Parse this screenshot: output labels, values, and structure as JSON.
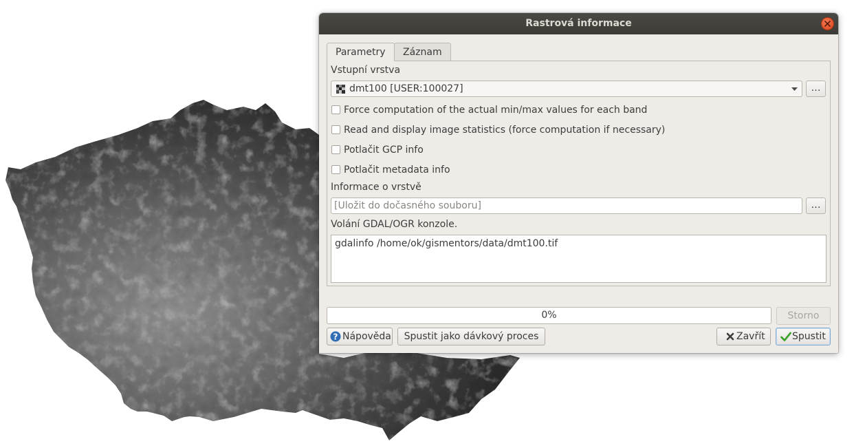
{
  "dialog": {
    "title": "Rastrová informace",
    "tabs": [
      {
        "label": "Parametry",
        "active": true
      },
      {
        "label": "Záznam",
        "active": false
      }
    ],
    "input_layer": {
      "label": "Vstupní vrstva",
      "selected": "dmt100 [USER:100027]",
      "browse_label": "…"
    },
    "options": [
      {
        "label": "Force computation of the actual min/max values for each band",
        "checked": false
      },
      {
        "label": "Read and display image statistics (force computation if necessary)",
        "checked": false
      },
      {
        "label": "Potlačit GCP info",
        "checked": false
      },
      {
        "label": "Potlačit metadata info",
        "checked": false
      }
    ],
    "output": {
      "label": "Informace o vrstvě",
      "placeholder": "[Uložit do dočasného souboru]",
      "browse_label": "…"
    },
    "console": {
      "label": "Volání GDAL/OGR konzole.",
      "command": "gdalinfo /home/ok/gismentors/data/dmt100.tif"
    },
    "progress": {
      "value": 0,
      "text": "0%"
    },
    "buttons": {
      "cancel": "Storno",
      "help": "Nápověda",
      "batch": "Spustit jako dávkový proces",
      "close": "Zavřít",
      "run": "Spustit"
    }
  },
  "colors": {
    "titlebar": "#3c3b37",
    "dialog_bg": "#efece8",
    "close_button": "#e2541f",
    "help_icon": "#2f6db5",
    "run_check": "#3fa32f"
  }
}
